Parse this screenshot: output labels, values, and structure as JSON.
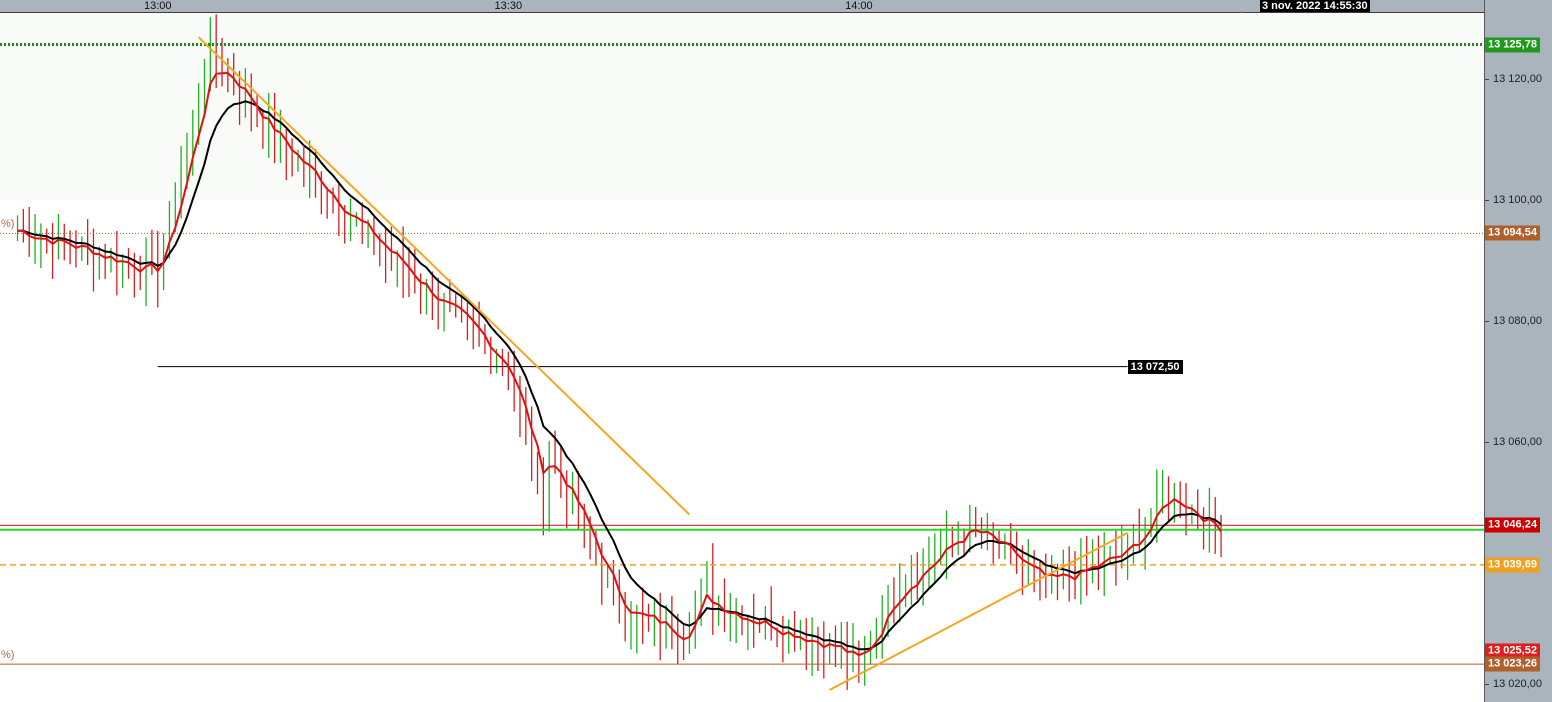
{
  "time_axis": {
    "labels": [
      {
        "text": "13:00",
        "bar": 24
      },
      {
        "text": "13:30",
        "bar": 84
      },
      {
        "text": "14:00",
        "bar": 144
      }
    ],
    "cursor_date": "3 nov. 2022 14:55:30"
  },
  "price_axis": {
    "ticks": [
      "13 120,00",
      "13 100,00",
      "13 080,00",
      "13 060,00",
      "13 020,00"
    ],
    "tick_values": [
      13120,
      13100,
      13080,
      13060,
      13020
    ]
  },
  "price_tags": [
    {
      "text": "13 125,78",
      "value": 13125.78,
      "color": "#1f9a1f"
    },
    {
      "text": "13 094,54",
      "value": 13094.54,
      "color": "#b0602c"
    },
    {
      "text": "13 046,24",
      "value": 13046.24,
      "color": "#cc0000"
    },
    {
      "text": "13 039,69",
      "value": 13039.69,
      "color": "#f0a020"
    },
    {
      "text": "13 025,52",
      "value": 13025.52,
      "color": "#e01e1e"
    },
    {
      "text": "13 023,26",
      "value": 13023.26,
      "color": "#b0602c"
    }
  ],
  "inline_tags": [
    {
      "text": "13 072,50",
      "value": 13072.5
    }
  ],
  "pct_labels": [
    {
      "text": "%)",
      "value": 13094.54
    },
    {
      "text": "%)",
      "value": 13023.26
    }
  ],
  "colors": {
    "up_bar": "#22b022",
    "down_bar": "#d42020",
    "fast_ma": "#e01010",
    "slow_ma": "#000000",
    "trendline": "#f5a623",
    "green_level": "#27d827",
    "high_level": "#1a8a1a",
    "pivot_level": "#b0602c",
    "dashed_level": "#f0a020",
    "red_level": "#c01010"
  },
  "chart_data": {
    "type": "line",
    "series": [],
    "x": [
      0,
      24,
      33,
      44,
      61,
      84,
      90,
      91,
      103,
      114,
      118,
      119,
      140,
      144,
      150,
      163,
      176,
      190,
      197,
      204,
      206
    ],
    "close": [
      13095,
      13088,
      13125,
      13110,
      13093,
      13072,
      13050,
      13058,
      13032,
      13028,
      13037,
      13033,
      13026,
      13023,
      13036,
      13046,
      13036,
      13042,
      13052,
      13046,
      13045
    ],
    "y_range": [
      13017,
      13131
    ],
    "x_range": [
      -3,
      251
    ],
    "levels": [
      13125.78,
      13094.54,
      13072.5,
      13046.24,
      13045.5,
      13039.69,
      13023.26
    ],
    "trendlines": [
      {
        "from": [
          31,
          13127
        ],
        "to": [
          115,
          13048
        ]
      },
      {
        "from": [
          139,
          13019
        ],
        "to": [
          190,
          13045
        ]
      }
    ]
  }
}
